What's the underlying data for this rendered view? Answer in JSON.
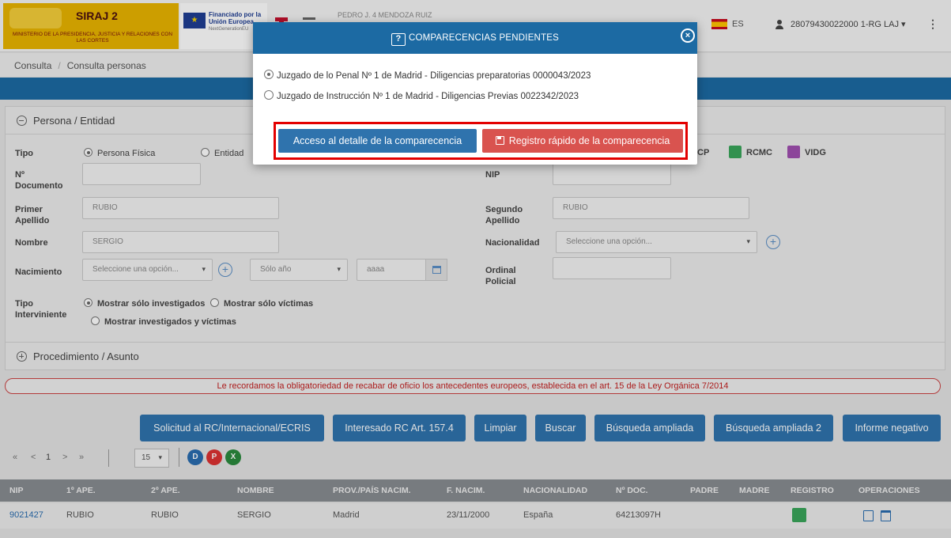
{
  "header": {
    "app_title": "SIRAJ 2",
    "ministry": "MINISTERIO DE LA PRESIDENCIA, JUSTICIA Y RELACIONES CON LAS CORTES",
    "eu_line": "Financiado por la Unión Europea",
    "eu_sub": "NextGenerationEU",
    "user_name": "PEDRO J. 4 MENDOZA RUIZ",
    "language": "ES",
    "account": "28079430022000 1-RG LAJ"
  },
  "breadcrumb": {
    "items": [
      "Consulta",
      "Consulta personas"
    ]
  },
  "form": {
    "section_persona": "Persona / Entidad",
    "section_procedimiento": "Procedimiento / Asunto",
    "tipo_label": "Tipo",
    "tipo_options": [
      "Persona Física",
      "Entidad"
    ],
    "nro_documento_label": "Nº Documento",
    "nip_label": "NIP",
    "primer_apellido_label": "Primer Apellido",
    "primer_apellido_value": "RUBIO",
    "segundo_apellido_label": "Segundo Apellido",
    "segundo_apellido_value": "RUBIO",
    "nombre_label": "Nombre",
    "nombre_value": "SERGIO",
    "nacionalidad_label": "Nacionalidad",
    "nacionalidad_placeholder": "Seleccione una opción...",
    "nacimiento_label": "Nacimiento",
    "nacimiento_placeholder": "Seleccione una opción...",
    "solo_anio": "Sólo año",
    "anio_placeholder": "aaaa",
    "ordinal_label": "Ordinal Policial",
    "tipo_interviniente_label": "Tipo Interviniente",
    "interviniente_options": [
      "Mostrar sólo investigados",
      "Mostrar sólo víctimas",
      "Mostrar investigados y víctimas"
    ],
    "legend": [
      {
        "label": "CP",
        "color": "#3aa55a"
      },
      {
        "label": "RCMC",
        "color": "#3aa55a"
      },
      {
        "label": "VIDG",
        "color": "#a04fb0"
      }
    ]
  },
  "notice": "Le recordamos la obligatoriedad de recabar de oficio los antecedentes europeos, establecida en el art. 15 de la Ley Orgánica 7/2014",
  "actions": {
    "solicitud": "Solicitud al RC/Internacional/ECRIS",
    "interesado": "Interesado RC Art. 157.4",
    "limpiar": "Limpiar",
    "buscar": "Buscar",
    "busqueda_ampliada": "Búsqueda ampliada",
    "busqueda_ampliada_2": "Búsqueda ampliada 2",
    "informe_negativo": "Informe negativo"
  },
  "pager": {
    "first": "«",
    "prev": "<",
    "page": "1",
    "next": ">",
    "last": "»",
    "per_page": "15"
  },
  "export": {
    "doc": "D",
    "pdf": "P",
    "xls": "X"
  },
  "table": {
    "headers": [
      "NIP",
      "1º APE.",
      "2º APE.",
      "NOMBRE",
      "PROV./PAÍS NACIM.",
      "F. NACIM.",
      "NACIONALIDAD",
      "Nº DOC.",
      "PADRE",
      "MADRE",
      "REGISTRO",
      "OPERACIONES"
    ],
    "rows": [
      {
        "nip": "9021427",
        "ape1": "RUBIO",
        "ape2": "RUBIO",
        "nombre": "SERGIO",
        "prov": "Madrid",
        "fnac": "23/11/2000",
        "nacionalidad": "España",
        "ndoc": "64213097H",
        "padre": "",
        "madre": ""
      }
    ]
  },
  "modal": {
    "title": "COMPARECENCIAS PENDIENTES",
    "options": [
      "Juzgado de lo Penal Nº 1 de Madrid - Diligencias preparatorias 0000043/2023",
      "Juzgado de Instrucción Nº 1 de Madrid - Diligencias Previas 0022342/2023"
    ],
    "btn_detalle": "Acceso al detalle de la comparecencia",
    "btn_registro": "Registro rápido de la comparecencia"
  },
  "colors": {
    "primary": "#2f73ad",
    "header_blue": "#1c6aa3",
    "danger": "#d9534f",
    "highlight": "#e30000"
  }
}
